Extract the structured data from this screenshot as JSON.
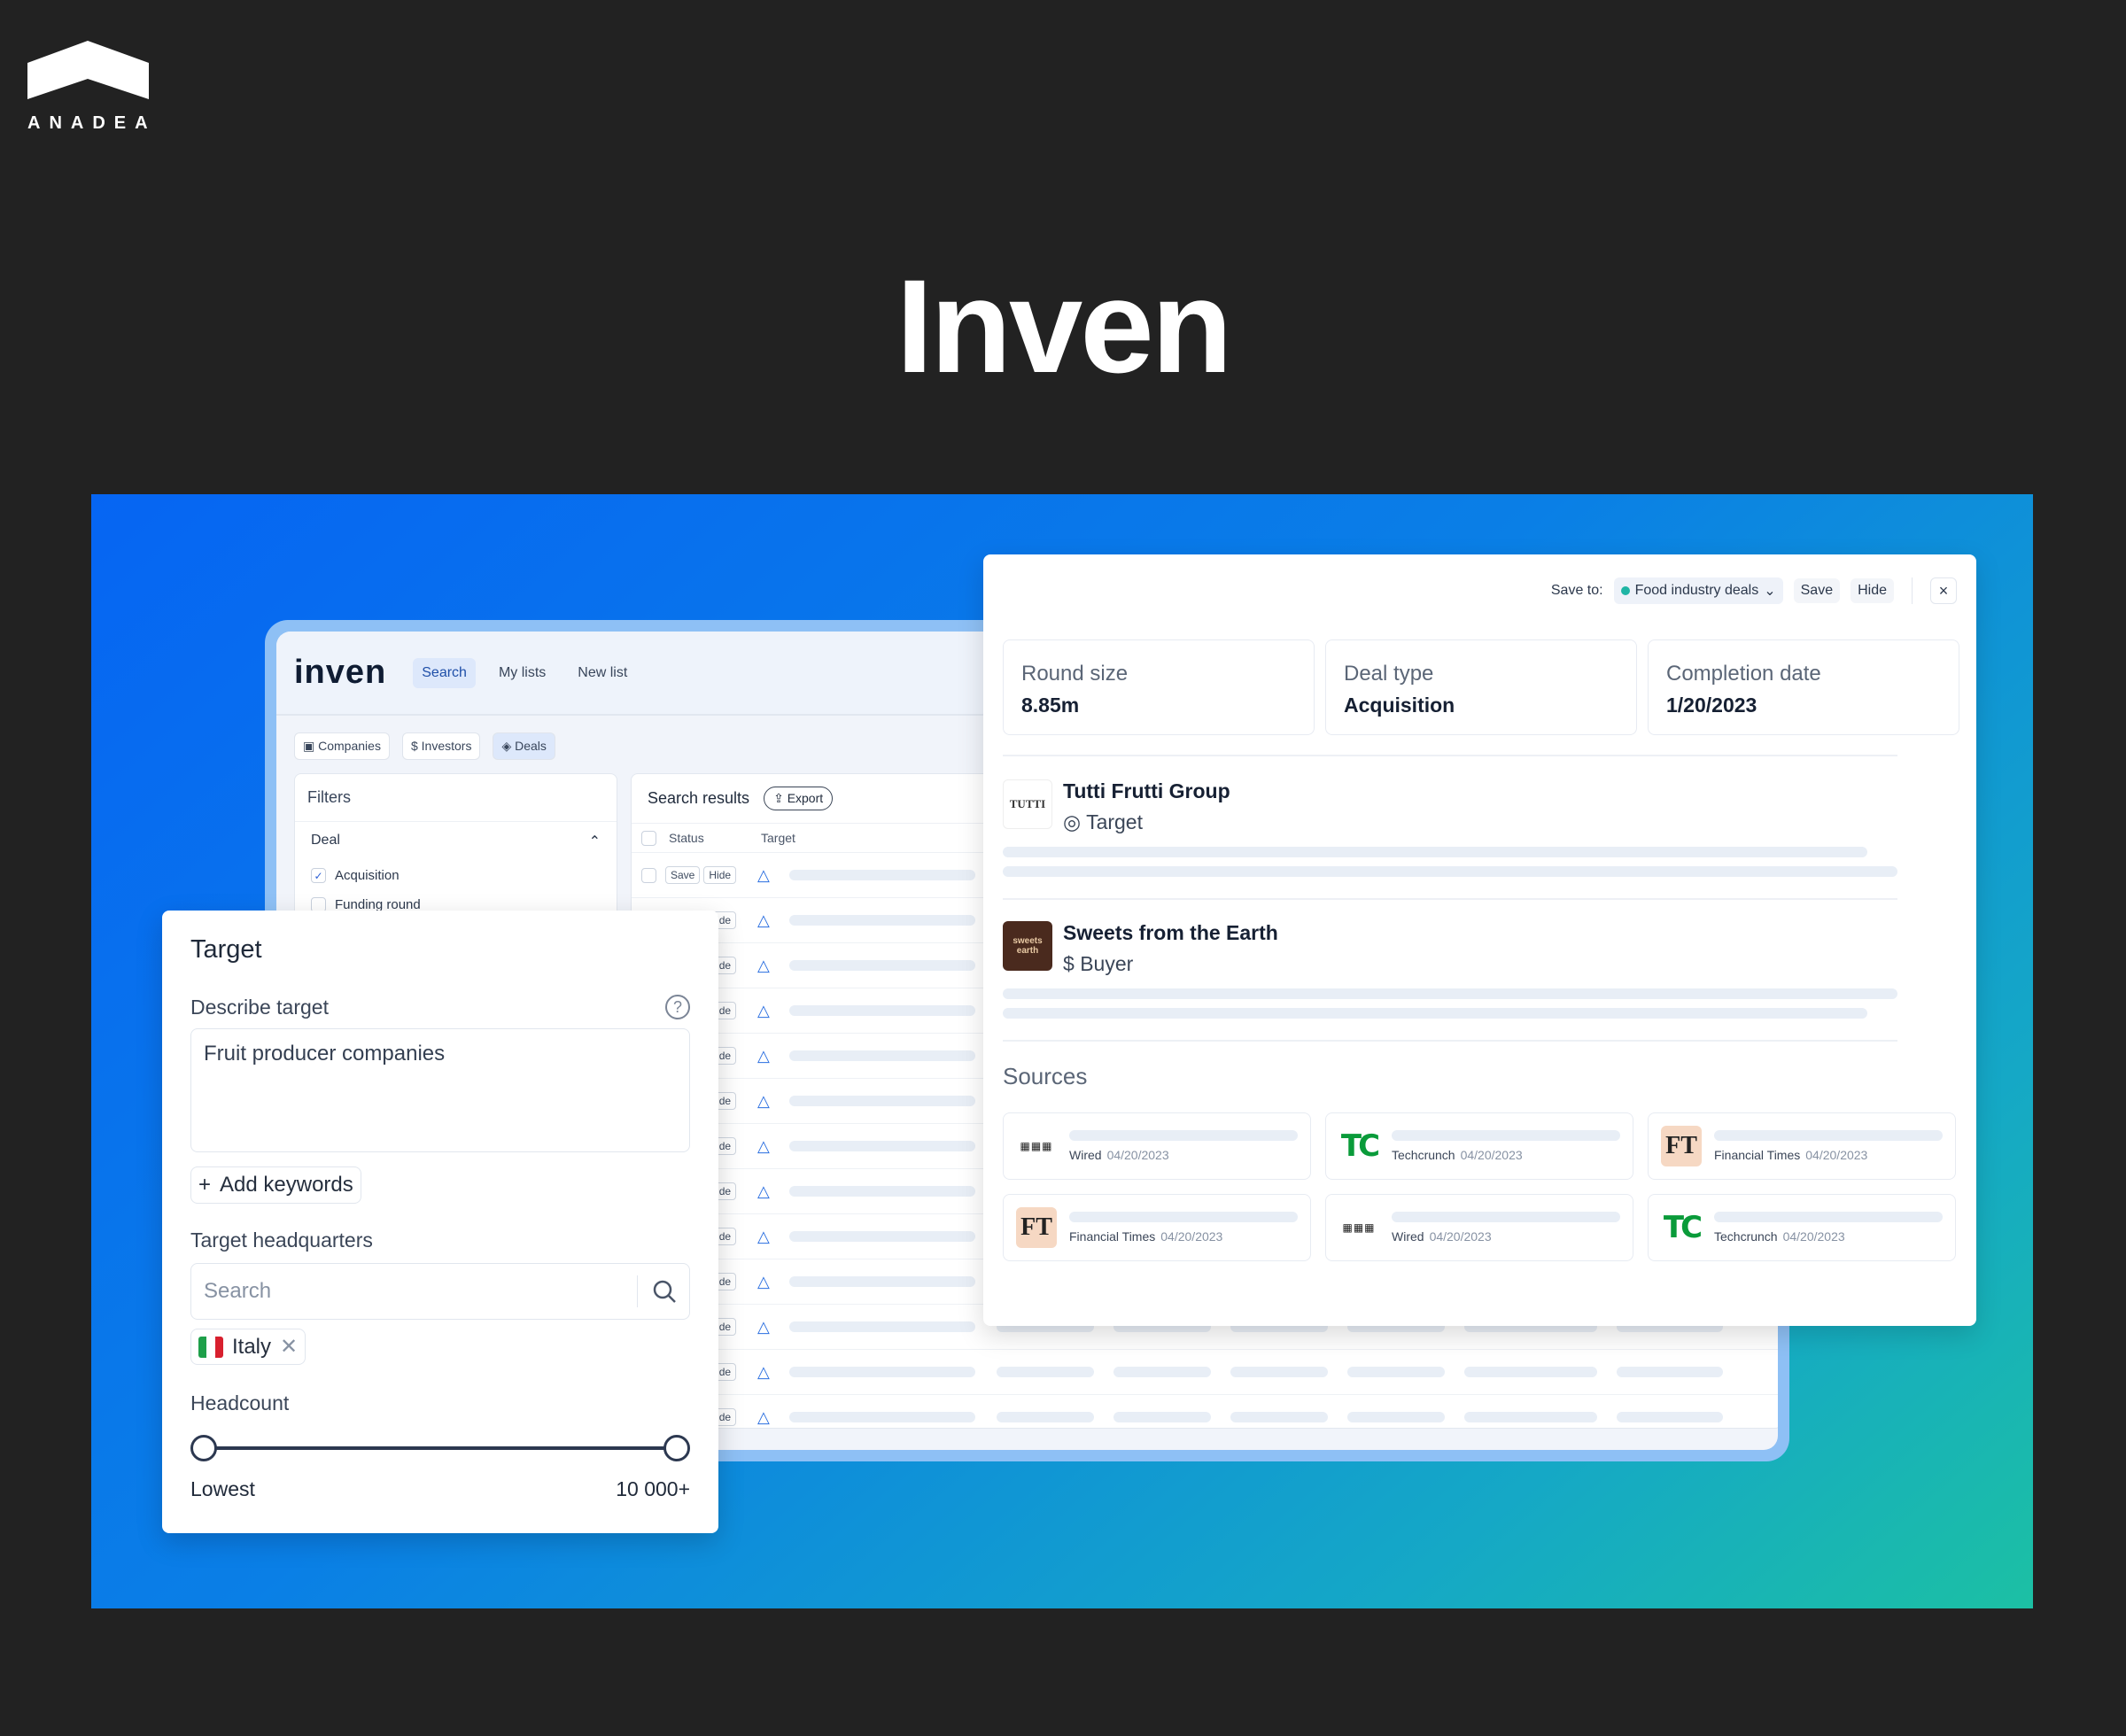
{
  "brand": {
    "name": "ANADEA"
  },
  "hero": {
    "title": "Inven"
  },
  "app": {
    "logo": "inven",
    "nav": [
      "Search",
      "My lists",
      "New list"
    ],
    "type_tabs": [
      "Companies",
      "Investors",
      "Deals"
    ],
    "filters": {
      "title": "Filters",
      "group": "Deal",
      "options": [
        {
          "label": "Acquisition",
          "checked": true
        },
        {
          "label": "Funding round",
          "checked": false
        }
      ]
    },
    "results": {
      "title": "Search results",
      "export_label": "Export",
      "columns": [
        "Status",
        "Target"
      ],
      "save_label": "Save",
      "hide_label": "Hide"
    }
  },
  "target_panel": {
    "title": "Target",
    "describe_label": "Describe target",
    "describe_value": "Fruit producer companies",
    "add_keywords": "Add keywords",
    "hq_label": "Target headquarters",
    "hq_placeholder": "Search",
    "selected_country": "Italy",
    "headcount_label": "Headcount",
    "headcount_min": "Lowest",
    "headcount_max": "10 000+"
  },
  "deal_panel": {
    "save_to_label": "Save to:",
    "save_to_list": "Food industry deals",
    "save_button": "Save",
    "hide_button": "Hide",
    "stats": [
      {
        "label": "Round size",
        "value": "8.85m"
      },
      {
        "label": "Deal type",
        "value": "Acquisition"
      },
      {
        "label": "Completion date",
        "value": "1/20/2023"
      }
    ],
    "target": {
      "name": "Tutti Frutti Group",
      "role": "Target",
      "logo_text": "TUTTI"
    },
    "buyer": {
      "name": "Sweets from the Earth",
      "role": "Buyer",
      "logo_text": "sweets earth"
    },
    "sources_title": "Sources",
    "sources": [
      {
        "name": "Wired",
        "date": "04/20/2023",
        "kind": "wired"
      },
      {
        "name": "Techcrunch",
        "date": "04/20/2023",
        "kind": "tc"
      },
      {
        "name": "Financial Times",
        "date": "04/20/2023",
        "kind": "ft"
      },
      {
        "name": "Financial Times",
        "date": "04/20/2023",
        "kind": "ft"
      },
      {
        "name": "Wired",
        "date": "04/20/2023",
        "kind": "wired"
      },
      {
        "name": "Techcrunch",
        "date": "04/20/2023",
        "kind": "tc"
      }
    ]
  }
}
